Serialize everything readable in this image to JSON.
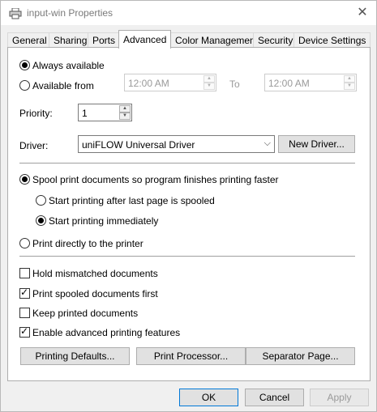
{
  "window": {
    "title": "input-win Properties",
    "close_glyph": "✕",
    "icon": "printer-icon"
  },
  "tabs": [
    {
      "label": "General"
    },
    {
      "label": "Sharing"
    },
    {
      "label": "Ports"
    },
    {
      "label": "Advanced",
      "active": true
    },
    {
      "label": "Color Management"
    },
    {
      "label": "Security"
    },
    {
      "label": "Device Settings"
    }
  ],
  "availability": {
    "always_label": "Always available",
    "from_label": "Available from",
    "from_time": "12:00 AM",
    "to_label": "To",
    "to_time": "12:00 AM",
    "selected": "always"
  },
  "priority": {
    "label": "Priority:",
    "value": "1"
  },
  "driver": {
    "label": "Driver:",
    "value": "uniFLOW Universal Driver",
    "new_driver_button": "New Driver..."
  },
  "spooling": {
    "spool_label": "Spool print documents so program finishes printing faster",
    "after_last_page_label": "Start printing after last page is spooled",
    "immediately_label": "Start printing immediately",
    "direct_label": "Print directly to the printer",
    "spool_selected": true,
    "start_mode": "immediately"
  },
  "options": [
    {
      "label": "Hold mismatched documents",
      "checked": false
    },
    {
      "label": "Print spooled documents first",
      "checked": true
    },
    {
      "label": "Keep printed documents",
      "checked": false
    },
    {
      "label": "Enable advanced printing features",
      "checked": true
    }
  ],
  "bottom_buttons": {
    "printing_defaults": "Printing Defaults...",
    "print_processor": "Print Processor...",
    "separator_page": "Separator Page..."
  },
  "dialog_buttons": {
    "ok": "OK",
    "cancel": "Cancel",
    "apply": "Apply"
  }
}
